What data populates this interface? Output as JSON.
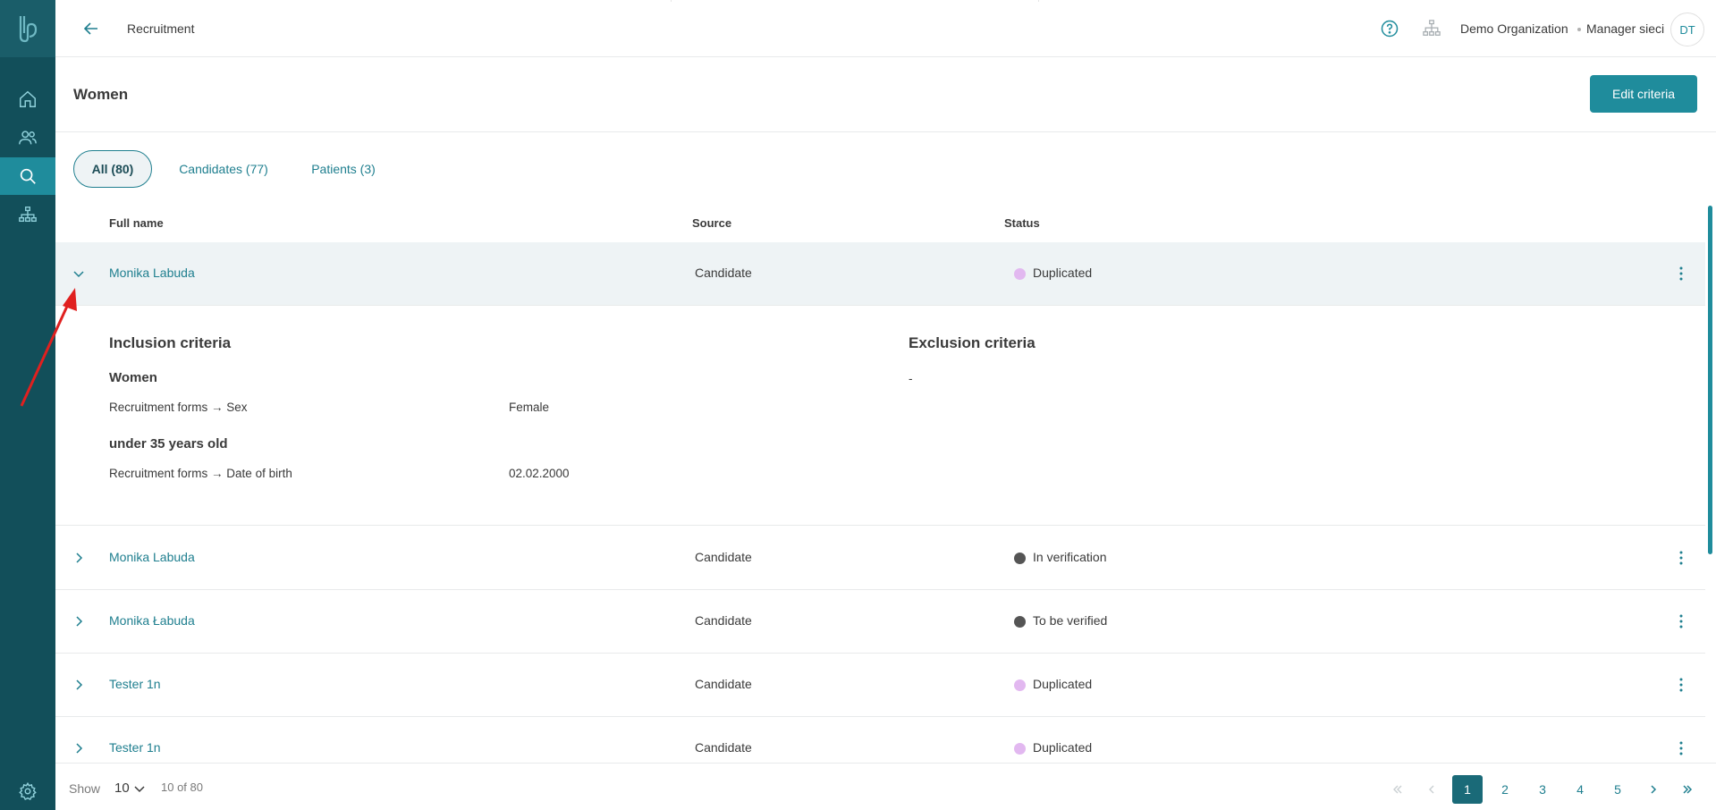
{
  "app": {
    "breadcrumb": "Recruitment",
    "organization": "Demo Organization",
    "role": "Manager sieci",
    "avatar_initials": "DT",
    "accent_color": "#1f8c9c",
    "sidebar_color": "#124f5a"
  },
  "sidebar": {
    "items": [
      {
        "icon": "home-icon"
      },
      {
        "icon": "users-icon"
      },
      {
        "icon": "search-icon",
        "active": true
      },
      {
        "icon": "hierarchy-icon"
      },
      {
        "icon": "gear-icon"
      }
    ]
  },
  "page": {
    "title": "Women",
    "edit_label": "Edit criteria"
  },
  "tabs": [
    {
      "label": "All (80)",
      "active": true
    },
    {
      "label": "Candidates (77)"
    },
    {
      "label": "Patients (3)"
    }
  ],
  "table": {
    "columns": [
      "Full name",
      "Source",
      "Status"
    ],
    "rows": [
      {
        "name": "Monika Labuda",
        "source": "Candidate",
        "status": "Duplicated",
        "status_color": "#e2b8f0",
        "expanded": true
      },
      {
        "name": "Monika Labuda",
        "source": "Candidate",
        "status": "In verification",
        "status_color": "#555555"
      },
      {
        "name": "Monika Łabuda",
        "source": "Candidate",
        "status": "To be verified",
        "status_color": "#555555"
      },
      {
        "name": "Tester 1n",
        "source": "Candidate",
        "status": "Duplicated",
        "status_color": "#e2b8f0"
      },
      {
        "name": "Tester 1n",
        "source": "Candidate",
        "status": "Duplicated",
        "status_color": "#e2b8f0"
      }
    ]
  },
  "detail": {
    "inclusion_title": "Inclusion criteria",
    "exclusion_title": "Exclusion criteria",
    "exclusion_value": "-",
    "groups": [
      {
        "title": "Women",
        "field": "Recruitment forms",
        "attribute": "Sex",
        "value": "Female"
      },
      {
        "title": "under 35 years old",
        "field": "Recruitment forms",
        "attribute": "Date of birth",
        "value": "02.02.2000"
      }
    ]
  },
  "footer": {
    "show_label": "Show",
    "page_size": "10",
    "range": "10 of 80",
    "pages": [
      "1",
      "2",
      "3",
      "4",
      "5"
    ],
    "current_page": "1"
  }
}
